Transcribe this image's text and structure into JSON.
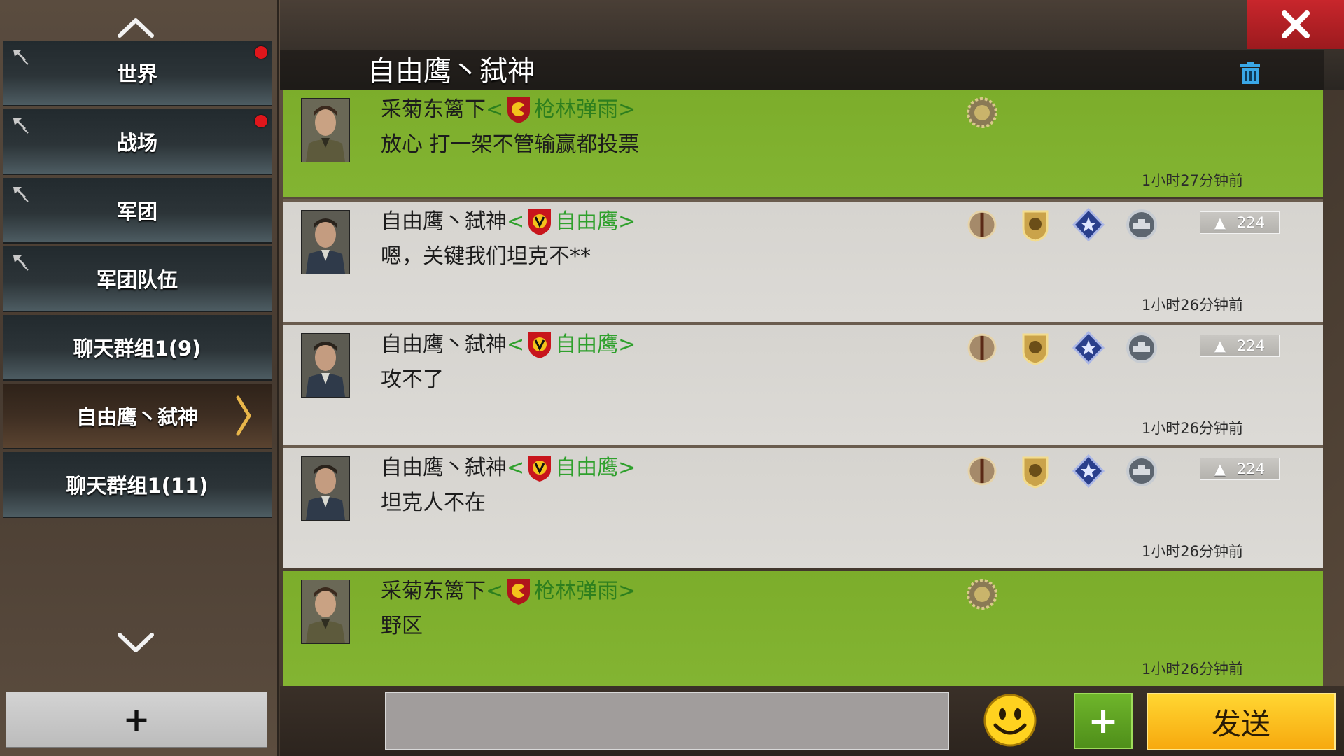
{
  "sidebar": {
    "channels": [
      {
        "label": "世界",
        "pinned": true,
        "unread": true
      },
      {
        "label": "战场",
        "pinned": true,
        "unread": true
      },
      {
        "label": "军团",
        "pinned": true,
        "unread": false
      },
      {
        "label": "军团队伍",
        "pinned": true,
        "unread": false
      },
      {
        "label": "聊天群组1(9)",
        "pinned": false,
        "unread": false
      },
      {
        "label": "自由鹰丶弑神",
        "pinned": false,
        "unread": false,
        "active": true
      },
      {
        "label": "聊天群组1(11)",
        "pinned": false,
        "unread": false
      }
    ],
    "add_label": "+"
  },
  "header": {
    "title": "自由鹰丶弑神"
  },
  "messages": [
    {
      "style": "green",
      "sender": "采菊东篱下",
      "guild_open": "<",
      "guild": "枪林弹雨",
      "guild_close": ">",
      "badge_color": "#e8c01e",
      "text": "放心 打一架不管输赢都投票",
      "time": "1小时27分钟前"
    },
    {
      "style": "gray",
      "sender": "自由鹰丶弑神",
      "guild_open": "<",
      "guild": "自由鹰",
      "guild_close": ">",
      "badge_color": "#c8151c",
      "text": "嗯，关键我们坦克不**",
      "time": "1小时26分钟前",
      "level": "224"
    },
    {
      "style": "gray",
      "sender": "自由鹰丶弑神",
      "guild_open": "<",
      "guild": "自由鹰",
      "guild_close": ">",
      "badge_color": "#c8151c",
      "text": "攻不了",
      "time": "1小时26分钟前",
      "level": "224"
    },
    {
      "style": "gray",
      "sender": "自由鹰丶弑神",
      "guild_open": "<",
      "guild": "自由鹰",
      "guild_close": ">",
      "badge_color": "#c8151c",
      "text": "坦克人不在",
      "time": "1小时26分钟前",
      "level": "224"
    },
    {
      "style": "green",
      "sender": "采菊东篱下",
      "guild_open": "<",
      "guild": "枪林弹雨",
      "guild_close": ">",
      "badge_color": "#e8c01e",
      "text": "野区",
      "time": "1小时26分钟前"
    }
  ],
  "input": {
    "placeholder": "",
    "value": ""
  },
  "buttons": {
    "plus_label": "+",
    "send_label": "发送"
  },
  "icons": {
    "close": "close-icon",
    "trash": "trash-icon",
    "emoji": "smiley-icon",
    "pin": "pin-icon",
    "scroll_up": "chevron-up-icon",
    "scroll_down": "chevron-down-icon"
  },
  "colors": {
    "green_message": "#7fb02e",
    "gray_message": "#d8d6d2",
    "send_button": "#fbbd1f",
    "close_button": "#b6222a",
    "guild_text": "#2fa02c",
    "unread_dot": "#e0161b"
  }
}
